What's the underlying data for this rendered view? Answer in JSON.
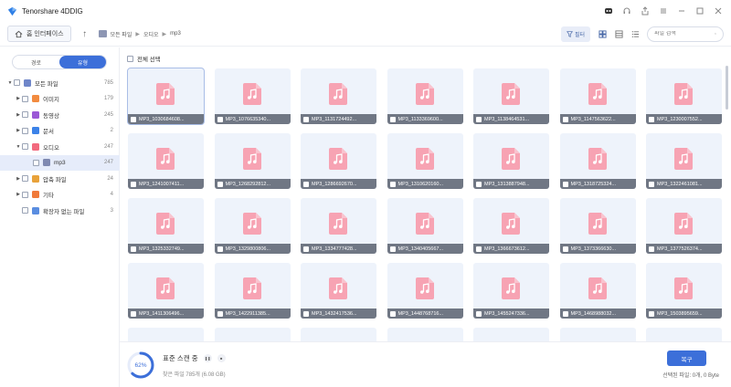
{
  "app": {
    "title": "Tenorshare 4DDIG"
  },
  "colors": {
    "accent": "#3c6fd9",
    "music_pink": "#f7a3b3",
    "card_bg": "#eef3fb",
    "label_bar": "#707784"
  },
  "navbar": {
    "home_label": "홈 인터페이스",
    "breadcrumbs": [
      "모든 파일",
      "오디오",
      "mp3"
    ],
    "filter_label": "필터",
    "search_placeholder": "파일 검색"
  },
  "sidebar": {
    "tabs": [
      "경로",
      "유형"
    ],
    "active_tab": "유형",
    "tree": [
      {
        "label": "모든 파일",
        "count": "785",
        "level": 0,
        "arrow": "▼",
        "icon": "folder-icon",
        "color": "#6f86c9"
      },
      {
        "label": "이미지",
        "count": "179",
        "level": 1,
        "arrow": "▶",
        "icon": "image-icon",
        "color": "#f28b40"
      },
      {
        "label": "동영상",
        "count": "245",
        "level": 1,
        "arrow": "▶",
        "icon": "video-icon",
        "color": "#9b59d6"
      },
      {
        "label": "문서",
        "count": "2",
        "level": 1,
        "arrow": "▶",
        "icon": "document-icon",
        "color": "#3c82e8"
      },
      {
        "label": "오디오",
        "count": "247",
        "level": 1,
        "arrow": "▼",
        "icon": "audio-icon",
        "color": "#f26a7e"
      },
      {
        "label": "mp3",
        "count": "247",
        "level": 2,
        "arrow": "",
        "icon": "folder-icon",
        "color": "#7f89b1"
      },
      {
        "label": "압축 파일",
        "count": "24",
        "level": 1,
        "arrow": "▶",
        "icon": "archive-icon",
        "color": "#e8a23a"
      },
      {
        "label": "기타",
        "count": "4",
        "level": 1,
        "arrow": "▶",
        "icon": "other-icon",
        "color": "#f07a3a"
      },
      {
        "label": "확장자 없는 파일",
        "count": "3",
        "level": 1,
        "arrow": "",
        "icon": "unknown-file-icon",
        "color": "#5a8de0"
      }
    ]
  },
  "content": {
    "select_all_label": "전체 선택",
    "files": [
      "MP3_1030684608...",
      "MP3_1076635340...",
      "MP3_1131724492...",
      "MP3_1133369600...",
      "MP3_1138464531...",
      "MP3_1147563622...",
      "MP3_1230007552...",
      "MP3_1241007411...",
      "MP3_1268292812...",
      "MP3_1286692670...",
      "MP3_1310620160...",
      "MP3_1313887948...",
      "MP3_1318725324...",
      "MP3_1322461081...",
      "MP3_1325332749...",
      "MP3_1329800806...",
      "MP3_1334777428...",
      "MP3_1340405667...",
      "MP3_1366673612...",
      "MP3_1373366630...",
      "MP3_1377526374...",
      "MP3_1411306496...",
      "MP3_1422911385...",
      "MP3_1432417536...",
      "MP3_1448768716...",
      "MP3_1455247336...",
      "MP3_1468988032...",
      "MP3_1503895659..."
    ]
  },
  "bottom": {
    "progress_percent": 62,
    "progress_label": "62%",
    "scan_status": "표준 스캔 중",
    "found_text": "찾은 파일 785개 (6.08 GB)",
    "recover_label": "복구",
    "selected_text": "선택된 파일: 0개, 0 Byte"
  }
}
